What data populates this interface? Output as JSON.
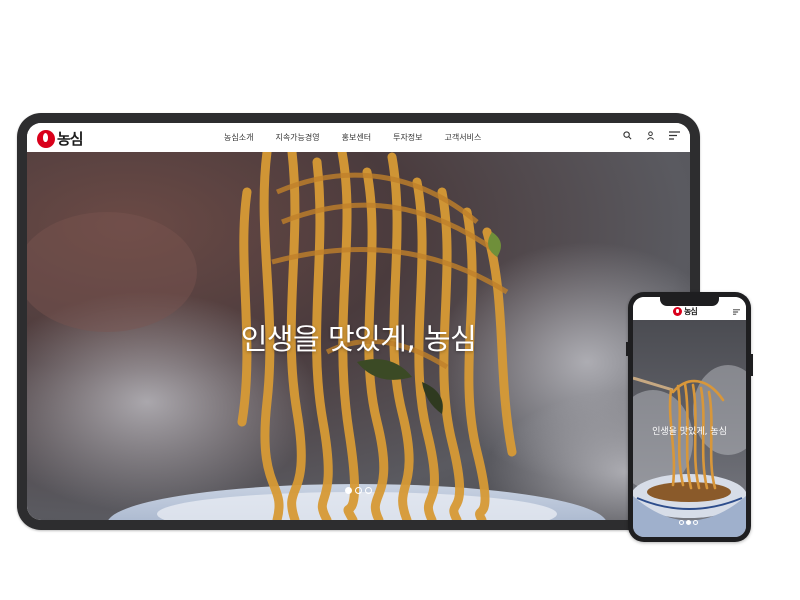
{
  "brand": {
    "name": "농심",
    "color": "#d9001b"
  },
  "nav": {
    "items": [
      "농심소개",
      "지속가능경영",
      "홍보센터",
      "투자정보",
      "고객서비스"
    ]
  },
  "header_icons": [
    "search-icon",
    "user-icon",
    "menu-icon"
  ],
  "hero": {
    "title": "인생을 맛있게, 농심",
    "slides": 3,
    "active_slide_tablet": 1,
    "active_slide_phone": 2
  },
  "mobile": {
    "hero_title": "인생을 맛있게, 농심"
  }
}
